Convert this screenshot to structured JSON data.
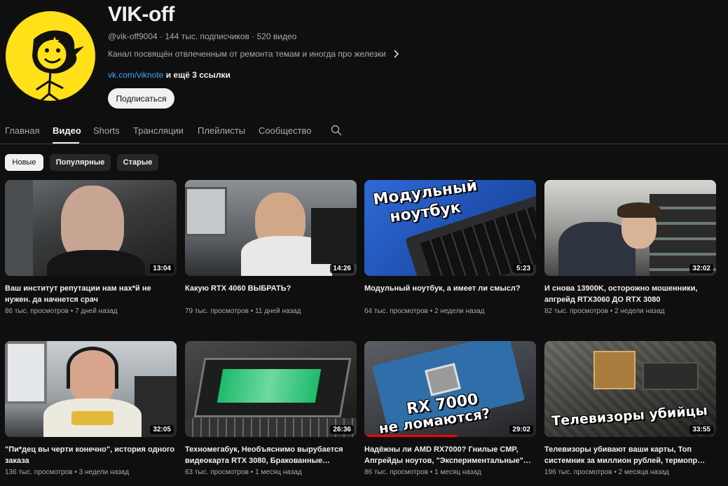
{
  "channel": {
    "name": "VIK-off",
    "handle": "@vik-off9004",
    "subscribers": "144 тыс. подписчиков",
    "video_count": "520 видео",
    "description": "Канал посвящён отвлеченным от ремонта темам и иногда про железки",
    "link": "vk.com/viknote",
    "more_links": " и ещё 3 ссылки",
    "subscribe_label": "Подписаться"
  },
  "tabs": [
    "Главная",
    "Видео",
    "Shorts",
    "Трансляции",
    "Плейлисты",
    "Сообщество"
  ],
  "active_tab": "Видео",
  "chips": [
    "Новые",
    "Популярные",
    "Старые"
  ],
  "active_chip": "Новые",
  "videos": [
    {
      "title": "Ваш институт репутации нам нах*й не нужен. да начнется срач",
      "views": "86 тыс. просмотров",
      "age": "7 дней назад",
      "duration": "13:04"
    },
    {
      "title": "Какую RTX 4060 ВЫБРАТЬ?",
      "views": "79 тыс. просмотров",
      "age": "11 дней назад",
      "duration": "14:26"
    },
    {
      "title": "Модульный ноутбук, а имеет ли смысл?",
      "views": "64 тыс. просмотров",
      "age": "2 недели назад",
      "duration": "5:23",
      "overlay": [
        "Модульный",
        "ноутбук"
      ]
    },
    {
      "title": "И снова 13900K, осторожно мошенники, апгрейд RTX3060 ДО RTX 3080",
      "views": "82 тыс. просмотров",
      "age": "2 недели назад",
      "duration": "32:02"
    },
    {
      "title": "\"Пи*дец вы черти конечно\", история одного заказа",
      "views": "136 тыс. просмотров",
      "age": "3 недели назад",
      "duration": "32:05"
    },
    {
      "title": "Техномегабук, Необъяснимо вырубается видеокарта RTX 3080, Бракованные…",
      "views": "63 тыс. просмотров",
      "age": "1 месяц назад",
      "duration": "26:36"
    },
    {
      "title": "Надёжны ли AMD RX7000? Гнилые CMP, Апгрейды ноутов, \"Экспериментальные\"…",
      "views": "86 тыс. просмотров",
      "age": "1 месяц назад",
      "duration": "29:02",
      "overlay": [
        "RX 7000",
        "не ломаются?"
      ]
    },
    {
      "title": "Телевизоры убивают ваши карты, Топ системник за миллион рублей, термопр…",
      "views": "196 тыс. просмотров",
      "age": "2 месяца назад",
      "duration": "33:55",
      "overlay": [
        "Телевизоры убийцы"
      ]
    }
  ],
  "colors": {
    "background": "#0f0f0f",
    "avatar_bg": "#ffe019",
    "link": "#3ea6ff",
    "progress": "#ff0000"
  },
  "icons": [
    "chevron-right-icon",
    "search-icon"
  ]
}
